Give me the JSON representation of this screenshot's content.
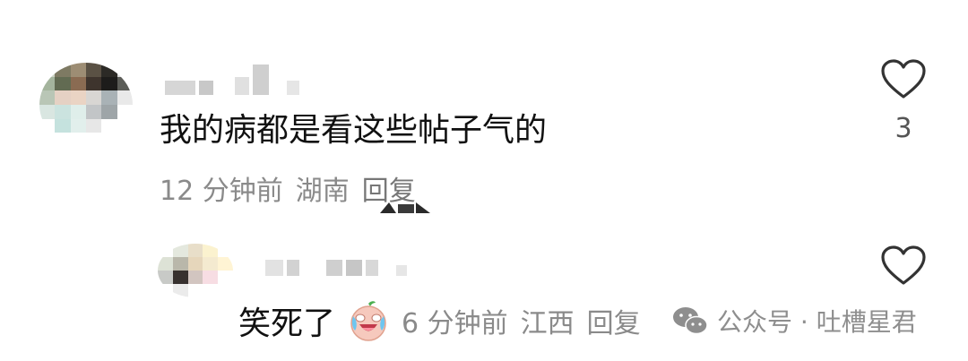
{
  "comment": {
    "text": "我的病都是看这些帖子气的",
    "time": "12 分钟前",
    "location": "湖南",
    "reply_label": "回复",
    "like_count": "3"
  },
  "reply": {
    "text": "笑死了",
    "emoji": "laughing-crying-emoji",
    "time": "6 分钟前",
    "location": "江西",
    "reply_label": "回复"
  },
  "watermark": {
    "text": "公众号 · 吐槽星君",
    "icon": "wechat-icon"
  },
  "colors": {
    "text": "#111111",
    "meta": "#8a8a8a",
    "heart_stroke": "#333333"
  }
}
